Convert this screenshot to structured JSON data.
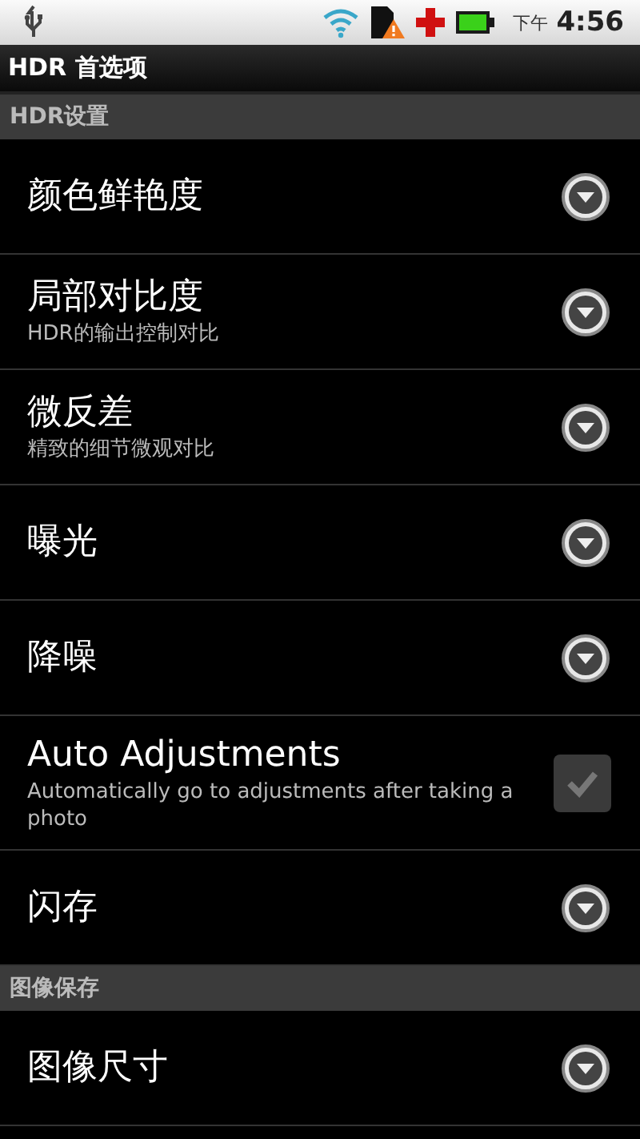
{
  "status_bar": {
    "period": "下午",
    "time": "4:56"
  },
  "window": {
    "title": "HDR 首选项"
  },
  "sections": [
    {
      "title": "HDR设置",
      "items": [
        {
          "kind": "dropdown",
          "title": "颜色鲜艳度"
        },
        {
          "kind": "dropdown",
          "title": "局部对比度",
          "summary": "HDR的输出控制对比"
        },
        {
          "kind": "dropdown",
          "title": "微反差",
          "summary": "精致的细节微观对比"
        },
        {
          "kind": "dropdown",
          "title": "曝光"
        },
        {
          "kind": "dropdown",
          "title": "降噪"
        },
        {
          "kind": "checkbox",
          "title": "Auto Adjustments",
          "summary": "Automatically go to adjustments after taking a photo",
          "checked": true,
          "disabled": true
        },
        {
          "kind": "dropdown",
          "title": "闪存"
        }
      ]
    },
    {
      "title": "图像保存",
      "items": [
        {
          "kind": "dropdown",
          "title": "图像尺寸"
        }
      ]
    }
  ]
}
